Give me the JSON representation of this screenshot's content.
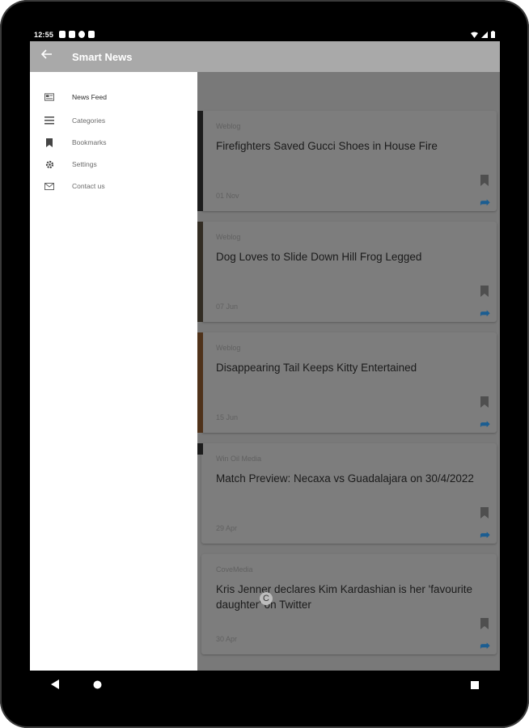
{
  "status_bar": {
    "time": "12:55",
    "left_icons": [
      "notification-icon",
      "notification-icon",
      "app-icon",
      "sd-card-icon"
    ],
    "right_icons": [
      "wifi-icon",
      "signal-icon",
      "battery-icon"
    ]
  },
  "app_bar": {
    "title": "Smart News",
    "back_icon": "arrow-back-icon",
    "color": "#a9a9a9"
  },
  "drawer": {
    "items": [
      {
        "label": "News Feed",
        "icon": "newspaper-icon",
        "active": true
      },
      {
        "label": "Categories",
        "icon": "list-icon",
        "active": false
      },
      {
        "label": "Bookmarks",
        "icon": "bookmark-icon",
        "active": false
      },
      {
        "label": "Settings",
        "icon": "gear-icon",
        "active": false
      },
      {
        "label": "Contact us",
        "icon": "mail-icon",
        "active": false
      }
    ]
  },
  "feed": {
    "cards": [
      {
        "source": "Weblog",
        "headline": "Firefighters Saved Gucci Shoes in House Fire",
        "date": "01 Nov"
      },
      {
        "source": "Weblog",
        "headline": "Dog Loves to Slide Down Hill Frog Legged",
        "date": "07 Jun"
      },
      {
        "source": "Weblog",
        "headline": "Disappearing Tail Keeps Kitty Entertained",
        "date": "15 Jun"
      },
      {
        "source": "Win Oil Media",
        "headline": "Match Preview: Necaxa vs Guadalajara on 30/4/2022",
        "date": "29 Apr"
      },
      {
        "source": "CoveMedia",
        "headline": "Kris Jenner declares Kim Kardashian is her 'favourite daughter' on Twitter",
        "date": "30 Apr"
      }
    ],
    "share_color": "#1f6aa5"
  },
  "loader_glyph": "C",
  "nav_bar": {
    "back_icon": "nav-back-icon",
    "home_icon": "nav-home-icon",
    "recents_icon": "nav-recents-icon"
  }
}
